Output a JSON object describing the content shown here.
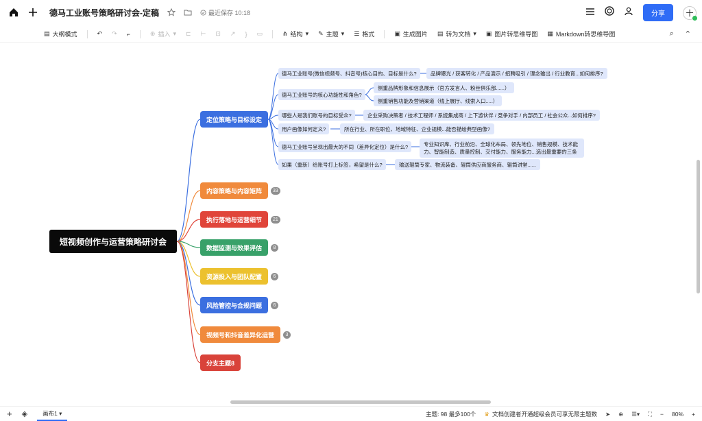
{
  "topbar": {
    "home_icon": "home-icon",
    "add_icon": "plus-icon",
    "title": "德马工业账号策略研讨会-定稿",
    "save_status": "最近保存 10:18",
    "share_label": "分享",
    "avatar_text": "十"
  },
  "toolbar": {
    "outline_mode": "大纲模式",
    "insert": "插入",
    "structure": "结构",
    "theme": "主题",
    "format": "格式",
    "generate_image": "生成图片",
    "to_document": "转为文档",
    "image_to_mindmap": "图片转思维导图",
    "markdown_to_mindmap": "Markdown转思维导图"
  },
  "mindmap": {
    "root": "短视频创作与运营策略研讨会",
    "branches": [
      {
        "label": "定位策略与目标设定",
        "color": "#3b6fe0",
        "badge": ""
      },
      {
        "label": "内容策略与内容矩阵",
        "color": "#f08a3c",
        "badge": "33"
      },
      {
        "label": "执行落地与运营细节",
        "color": "#e0453a",
        "badge": "21"
      },
      {
        "label": "数据监测与效果评估",
        "color": "#38a169",
        "badge": "8"
      },
      {
        "label": "资源投入与团队配置",
        "color": "#ecc12e",
        "badge": "6"
      },
      {
        "label": "风险管控与合规问题",
        "color": "#3b6fe0",
        "badge": "6"
      },
      {
        "label": "视频号和抖音差异化运营",
        "color": "#f08a3c",
        "badge": "3"
      },
      {
        "label": "分支主题8",
        "color": "#d9433a",
        "badge": ""
      }
    ],
    "questions": [
      {
        "q": "德马工业账号(微信视频号、抖音号)核心目的、目标是什么?",
        "answers": [
          "品牌曝光 / 获客转化 / 产品演示 / 招聘吸引 / 理念输出 / 行业教育...如何排序?"
        ]
      },
      {
        "q": "德马工业账号的核心功能性和角色?",
        "answers": [
          "侧重品牌形象和信息展示（官方发言人、粉丝俱乐部......）",
          "侧重销售功能及营销渠道（线上展厅、线索入口.....）"
        ]
      },
      {
        "q": "哪些人是我们账号的目标受众?",
        "answers": [
          "企业采购决策者 / 技术工程师 / 系统集成商 / 上下游伙伴 / 竞争对手 / 内部员工 / 社会公众...如何排序?"
        ]
      },
      {
        "q": "用户画像如何定义?",
        "answers": [
          "所在行业、所在职位、地域特征、企业规模...能否描绘典型画像?"
        ]
      },
      {
        "q": "德马工业账号呈现出最大的不同（差异化定位）是什么?",
        "answers": [
          "专业知识库、行业前沿、全球化布局、领先地位、销售规模、技术能力、智能制造、质量控制、交付能力、服务能力...选出最重要的三条"
        ]
      },
      {
        "q": "如果（重新）给账号打上标签，希望是什么?",
        "answers": [
          "输送辊筒专家、物流装备、辊筒供应商服务商、辊筒讲堂......"
        ]
      }
    ]
  },
  "statusbar": {
    "canvas_tab": "画布1",
    "topic_count": "主题: 98 最多100个",
    "notice": "文档创建者开通超级会员可享无限主题数",
    "zoom": "80%"
  }
}
